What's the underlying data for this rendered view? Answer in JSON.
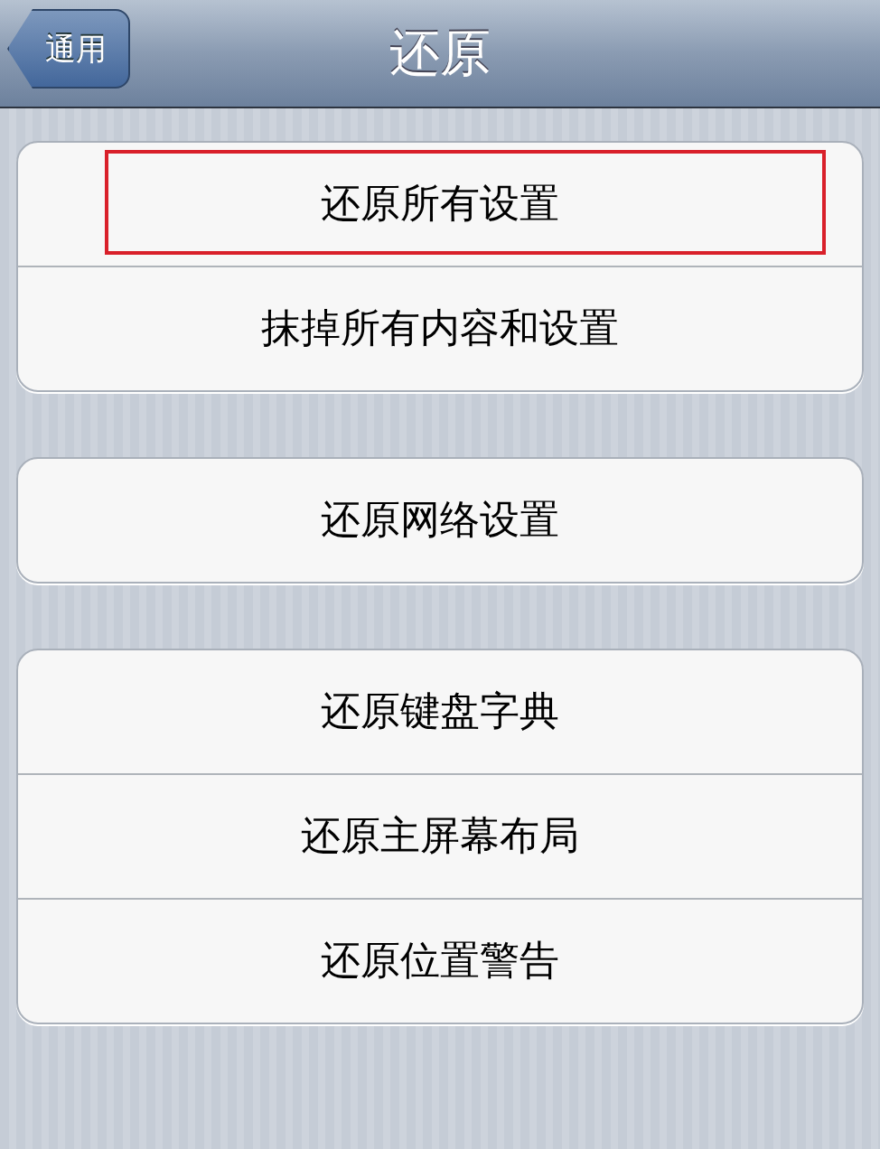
{
  "nav_bar": {
    "back_button": "通用",
    "title": "还原"
  },
  "groups": [
    {
      "items": [
        {
          "label": "还原所有设置",
          "highlighted": true
        },
        {
          "label": "抹掉所有内容和设置",
          "highlighted": false
        }
      ]
    },
    {
      "items": [
        {
          "label": "还原网络设置",
          "highlighted": false
        }
      ]
    },
    {
      "items": [
        {
          "label": "还原键盘字典",
          "highlighted": false
        },
        {
          "label": "还原主屏幕布局",
          "highlighted": false
        },
        {
          "label": "还原位置警告",
          "highlighted": false
        }
      ]
    }
  ]
}
